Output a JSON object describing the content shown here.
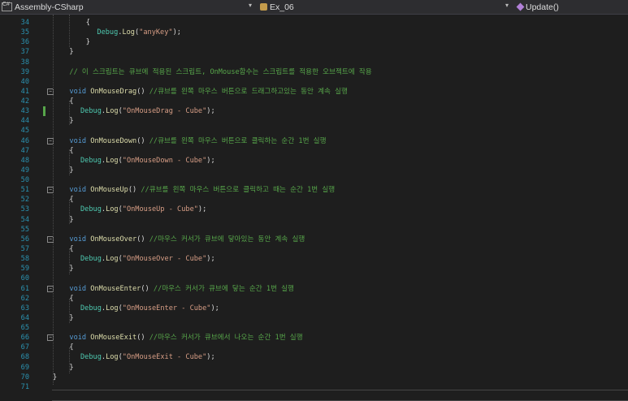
{
  "navbar": {
    "project": "Assembly-CSharp",
    "class": "Ex_06",
    "method": "Update()"
  },
  "lines": [
    {
      "n": "34",
      "indent": 6,
      "parts": [
        {
          "t": "{",
          "c": ""
        }
      ]
    },
    {
      "n": "35",
      "indent": 8,
      "parts": [
        {
          "t": "Debug",
          "c": "ty"
        },
        {
          "t": ".",
          "c": ""
        },
        {
          "t": "Log",
          "c": "fn"
        },
        {
          "t": "(",
          "c": ""
        },
        {
          "t": "\"anyKey\"",
          "c": "st"
        },
        {
          "t": ");",
          "c": ""
        }
      ]
    },
    {
      "n": "36",
      "indent": 6,
      "parts": [
        {
          "t": "}",
          "c": ""
        }
      ]
    },
    {
      "n": "37",
      "indent": 3,
      "parts": [
        {
          "t": "}",
          "c": ""
        }
      ]
    },
    {
      "n": "38",
      "indent": 0,
      "parts": []
    },
    {
      "n": "39",
      "indent": 3,
      "parts": [
        {
          "t": "// 이 스크립트는 큐브에 적용된 스크립트, OnMouse함수는 스크립트를 적용한 오브젝트에 작용",
          "c": "cm"
        }
      ]
    },
    {
      "n": "40",
      "indent": 0,
      "parts": []
    },
    {
      "n": "41",
      "indent": 3,
      "fold": true,
      "parts": [
        {
          "t": "void ",
          "c": "kw"
        },
        {
          "t": "OnMouseDrag",
          "c": "fn"
        },
        {
          "t": "() ",
          "c": ""
        },
        {
          "t": "//큐브를 왼쪽 마우스 버튼으로 드래그하고있는 동안 계속 실행",
          "c": "cm"
        }
      ]
    },
    {
      "n": "42",
      "indent": 3,
      "parts": [
        {
          "t": "{",
          "c": ""
        }
      ]
    },
    {
      "n": "43",
      "indent": 5,
      "changed": true,
      "parts": [
        {
          "t": "Debug",
          "c": "ty"
        },
        {
          "t": ".",
          "c": ""
        },
        {
          "t": "Log",
          "c": "fn"
        },
        {
          "t": "(",
          "c": ""
        },
        {
          "t": "\"OnMouseDrag - Cube\"",
          "c": "st"
        },
        {
          "t": ");",
          "c": ""
        }
      ]
    },
    {
      "n": "44",
      "indent": 3,
      "parts": [
        {
          "t": "}",
          "c": ""
        }
      ]
    },
    {
      "n": "45",
      "indent": 0,
      "parts": []
    },
    {
      "n": "46",
      "indent": 3,
      "fold": true,
      "parts": [
        {
          "t": "void ",
          "c": "kw"
        },
        {
          "t": "OnMouseDown",
          "c": "fn"
        },
        {
          "t": "() ",
          "c": ""
        },
        {
          "t": "//큐브를 왼쪽 마우스 버튼으로 클릭하는 순간 1번 실행",
          "c": "cm"
        }
      ]
    },
    {
      "n": "47",
      "indent": 3,
      "parts": [
        {
          "t": "{",
          "c": ""
        }
      ]
    },
    {
      "n": "48",
      "indent": 5,
      "parts": [
        {
          "t": "Debug",
          "c": "ty"
        },
        {
          "t": ".",
          "c": ""
        },
        {
          "t": "Log",
          "c": "fn"
        },
        {
          "t": "(",
          "c": ""
        },
        {
          "t": "\"OnMouseDown - Cube\"",
          "c": "st"
        },
        {
          "t": ");",
          "c": ""
        }
      ]
    },
    {
      "n": "49",
      "indent": 3,
      "parts": [
        {
          "t": "}",
          "c": ""
        }
      ]
    },
    {
      "n": "50",
      "indent": 0,
      "parts": []
    },
    {
      "n": "51",
      "indent": 3,
      "fold": true,
      "parts": [
        {
          "t": "void ",
          "c": "kw"
        },
        {
          "t": "OnMouseUp",
          "c": "fn"
        },
        {
          "t": "() ",
          "c": ""
        },
        {
          "t": "//큐브를 왼쪽 마우스 버튼으로 클릭하고 때는 순간 1번 실행",
          "c": "cm"
        }
      ]
    },
    {
      "n": "52",
      "indent": 3,
      "parts": [
        {
          "t": "{",
          "c": ""
        }
      ]
    },
    {
      "n": "53",
      "indent": 5,
      "parts": [
        {
          "t": "Debug",
          "c": "ty"
        },
        {
          "t": ".",
          "c": ""
        },
        {
          "t": "Log",
          "c": "fn"
        },
        {
          "t": "(",
          "c": ""
        },
        {
          "t": "\"OnMouseUp - Cube\"",
          "c": "st"
        },
        {
          "t": ");",
          "c": ""
        }
      ]
    },
    {
      "n": "54",
      "indent": 3,
      "parts": [
        {
          "t": "}",
          "c": ""
        }
      ]
    },
    {
      "n": "55",
      "indent": 0,
      "parts": []
    },
    {
      "n": "56",
      "indent": 3,
      "fold": true,
      "parts": [
        {
          "t": "void ",
          "c": "kw"
        },
        {
          "t": "OnMouseOver",
          "c": "fn"
        },
        {
          "t": "() ",
          "c": ""
        },
        {
          "t": "//마우스 커서가 큐브에 닿아있는 동안 계속 실행",
          "c": "cm"
        }
      ]
    },
    {
      "n": "57",
      "indent": 3,
      "parts": [
        {
          "t": "{",
          "c": ""
        }
      ]
    },
    {
      "n": "58",
      "indent": 5,
      "parts": [
        {
          "t": "Debug",
          "c": "ty"
        },
        {
          "t": ".",
          "c": ""
        },
        {
          "t": "Log",
          "c": "fn"
        },
        {
          "t": "(",
          "c": ""
        },
        {
          "t": "\"OnMouseOver - Cube\"",
          "c": "st"
        },
        {
          "t": ");",
          "c": ""
        }
      ]
    },
    {
      "n": "59",
      "indent": 3,
      "parts": [
        {
          "t": "}",
          "c": ""
        }
      ]
    },
    {
      "n": "60",
      "indent": 0,
      "parts": []
    },
    {
      "n": "61",
      "indent": 3,
      "fold": true,
      "parts": [
        {
          "t": "void ",
          "c": "kw"
        },
        {
          "t": "OnMouseEnter",
          "c": "fn"
        },
        {
          "t": "() ",
          "c": ""
        },
        {
          "t": "//마우스 커서가 큐브에 닿는 순간 1번 실행",
          "c": "cm"
        }
      ]
    },
    {
      "n": "62",
      "indent": 3,
      "parts": [
        {
          "t": "{",
          "c": ""
        }
      ]
    },
    {
      "n": "63",
      "indent": 5,
      "parts": [
        {
          "t": "Debug",
          "c": "ty"
        },
        {
          "t": ".",
          "c": ""
        },
        {
          "t": "Log",
          "c": "fn"
        },
        {
          "t": "(",
          "c": ""
        },
        {
          "t": "\"OnMouseEnter - Cube\"",
          "c": "st"
        },
        {
          "t": ");",
          "c": ""
        }
      ]
    },
    {
      "n": "64",
      "indent": 3,
      "parts": [
        {
          "t": "}",
          "c": ""
        }
      ]
    },
    {
      "n": "65",
      "indent": 0,
      "parts": []
    },
    {
      "n": "66",
      "indent": 3,
      "fold": true,
      "parts": [
        {
          "t": "void ",
          "c": "kw"
        },
        {
          "t": "OnMouseExit",
          "c": "fn"
        },
        {
          "t": "() ",
          "c": ""
        },
        {
          "t": "//마우스 커서가 큐브에서 나오는 순간 1번 실행",
          "c": "cm"
        }
      ]
    },
    {
      "n": "67",
      "indent": 3,
      "parts": [
        {
          "t": "{",
          "c": ""
        }
      ]
    },
    {
      "n": "68",
      "indent": 5,
      "parts": [
        {
          "t": "Debug",
          "c": "ty"
        },
        {
          "t": ".",
          "c": ""
        },
        {
          "t": "Log",
          "c": "fn"
        },
        {
          "t": "(",
          "c": ""
        },
        {
          "t": "\"OnMouseExit - Cube\"",
          "c": "st"
        },
        {
          "t": ");",
          "c": ""
        }
      ]
    },
    {
      "n": "69",
      "indent": 3,
      "parts": [
        {
          "t": "}",
          "c": ""
        }
      ]
    },
    {
      "n": "70",
      "indent": 0,
      "parts": [
        {
          "t": "}",
          "c": ""
        }
      ]
    },
    {
      "n": "71",
      "indent": 0,
      "parts": []
    }
  ]
}
